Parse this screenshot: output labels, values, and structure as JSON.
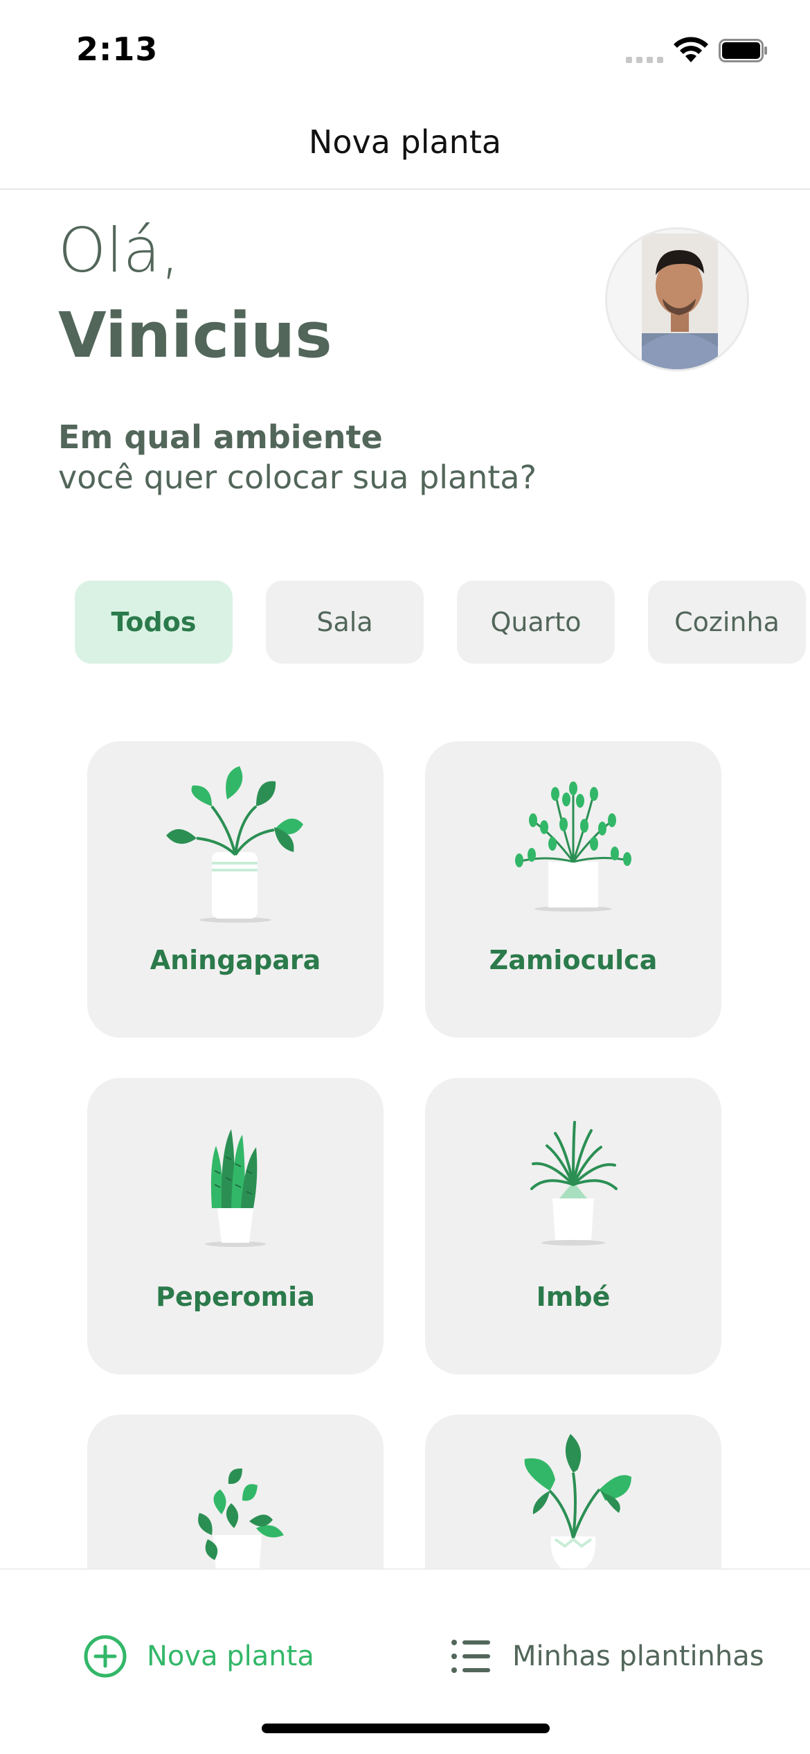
{
  "status_bar": {
    "time": "2:13",
    "icons": [
      "signal-icon",
      "wifi-icon",
      "battery-icon"
    ]
  },
  "header": {
    "title": "Nova planta"
  },
  "greeting": {
    "hello": "Olá,",
    "name": "Vinicius",
    "avatar_icon": "user-avatar"
  },
  "question": {
    "bold": "Em qual ambiente",
    "rest": "você quer colocar sua planta?"
  },
  "environments": [
    {
      "label": "Todos",
      "selected": true
    },
    {
      "label": "Sala",
      "selected": false
    },
    {
      "label": "Quarto",
      "selected": false
    },
    {
      "label": "Cozinha",
      "selected": false
    }
  ],
  "plants": [
    {
      "name": "Aningapara",
      "icon": "pothos-plant-icon"
    },
    {
      "name": "Zamioculca",
      "icon": "fern-plant-icon"
    },
    {
      "name": "Peperomia",
      "icon": "snake-plant-icon"
    },
    {
      "name": "Imbé",
      "icon": "spider-plant-icon"
    },
    {
      "name": "",
      "icon": "ivy-plant-icon"
    },
    {
      "name": "",
      "icon": "caladium-plant-icon"
    }
  ],
  "tabbar": {
    "new_plant": "Nova planta",
    "my_plants": "Minhas plantinhas"
  },
  "colors": {
    "green": "#32B768",
    "dark_green": "#2B7A4B",
    "heading": "#52665A",
    "chip_bg": "#F0F0F0",
    "chip_active_bg": "#DAF2E4",
    "card_bg": "#F0F0F0"
  }
}
